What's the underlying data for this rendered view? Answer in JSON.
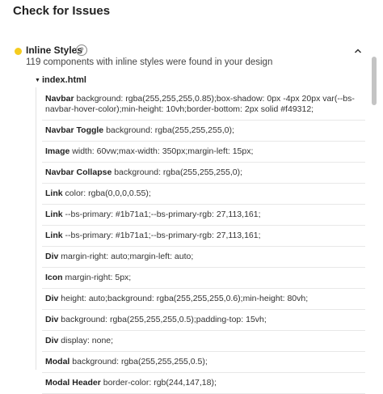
{
  "page": {
    "title": "Check for Issues"
  },
  "issue": {
    "title": "Inline Styles",
    "help_glyph": "?",
    "summary": "119 components with inline styles were found in your design",
    "status_color": "#f5cc1f",
    "file": "index.html",
    "rows": [
      {
        "component": "Navbar",
        "style": "background: rgba(255,255,255,0.85);box-shadow: 0px -4px 20px var(--bs-navbar-hover-color);min-height: 10vh;border-bottom: 2px solid #f49312;"
      },
      {
        "component": "Navbar Toggle",
        "style": "background: rgba(255,255,255,0);"
      },
      {
        "component": "Image",
        "style": "width: 60vw;max-width: 350px;margin-left: 15px;"
      },
      {
        "component": "Navbar Collapse",
        "style": "background: rgba(255,255,255,0);"
      },
      {
        "component": "Link",
        "style": "color: rgba(0,0,0,0.55);"
      },
      {
        "component": "Link",
        "style": "--bs-primary: #1b71a1;--bs-primary-rgb: 27,113,161;"
      },
      {
        "component": "Link",
        "style": "--bs-primary: #1b71a1;--bs-primary-rgb: 27,113,161;"
      },
      {
        "component": "Div",
        "style": "margin-right: auto;margin-left: auto;"
      },
      {
        "component": "Icon",
        "style": "margin-right: 5px;"
      },
      {
        "component": "Div",
        "style": "height: auto;background: rgba(255,255,255,0.6);min-height: 80vh;"
      },
      {
        "component": "Div",
        "style": "background: rgba(255,255,255,0.5);padding-top: 15vh;"
      },
      {
        "component": "Div",
        "style": "display: none;"
      },
      {
        "component": "Modal",
        "style": "background: rgba(255,255,255,0.5);"
      },
      {
        "component": "Modal Header",
        "style": "border-color: rgb(244,147,18);"
      }
    ]
  }
}
